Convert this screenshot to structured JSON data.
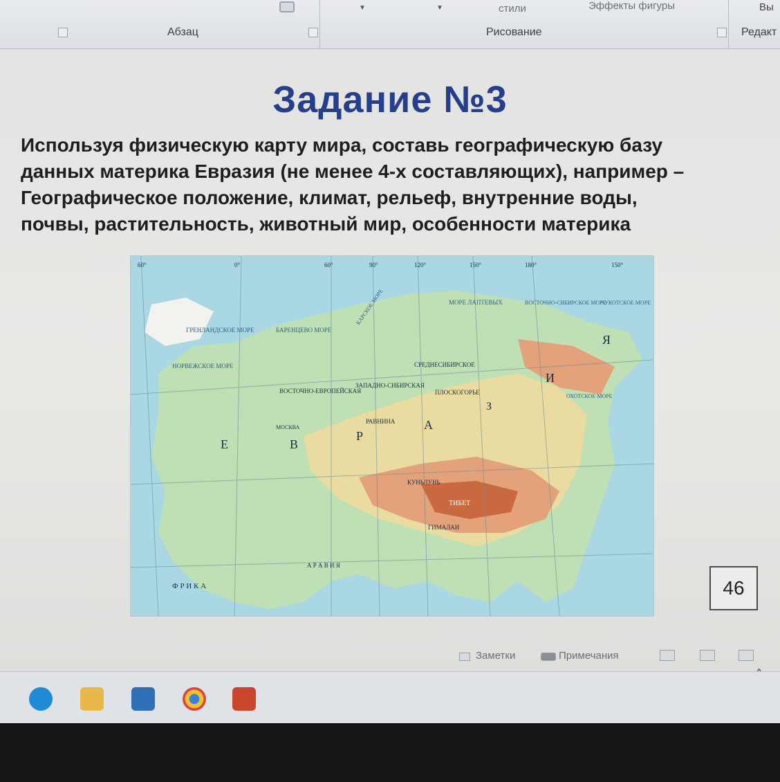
{
  "ribbon": {
    "paragraph_label": "Абзац",
    "drawing_label": "Рисование",
    "edit_label": "Редакт",
    "styles_label": "стили",
    "shape_effects_label": "Эффекты фигуры",
    "select_label": "Вы"
  },
  "slide": {
    "title": "Задание №3",
    "task_lines": [
      "Используя физическую карту мира, составь географическую базу",
      "данных материка Евразия (не менее 4-х составляющих), например –",
      "Географическое положение, климат, рельеф, внутренние воды,",
      "почвы, растительность, животный мир, особенности материка"
    ],
    "page_number": "46"
  },
  "map": {
    "labels": {
      "e": "Е",
      "v": "В",
      "r": "Р",
      "a": "А",
      "z": "З",
      "i": "И",
      "ya": "Я",
      "arabian": "А Р А В И Я",
      "africa": "Ф Р И К А",
      "greenland": "ГРЕНЛАНДСКОЕ МОРЕ",
      "barents": "БАРЕНЦЕВО МОРЕ",
      "norwegian": "НОРВЕЖСКОЕ МОРЕ",
      "kara": "КАРСКОЕ МОРЕ",
      "laptev": "МОРЕ ЛАПТЕВЫХ",
      "east_sib": "ВОСТОЧНО-СИБИРСКОЕ МОРЕ",
      "chukchi": "ЧУКОТСКОЕ МОРЕ",
      "okhotsk": "ОХОТСКОЕ МОРЕ",
      "mid_sib": "СРЕДНЕСИБИРСКОЕ",
      "plateau": "ПЛОСКОГОРЬЕ",
      "east_euro": "ВОСТОЧНО-ЕВРОПЕЙСКАЯ",
      "west_sib": "ЗАПАДНО-СИБИРСКАЯ",
      "plain": "РАВНИНА",
      "tibet": "ТИБЕТ",
      "moscow": "МОСКВА",
      "kunlun": "КУНЬЛУНЬ",
      "himalaya": "ГИМАЛАИ"
    },
    "meridians": [
      "60°",
      "0°",
      "60°",
      "90°",
      "120°",
      "150°",
      "180°",
      "150°"
    ],
    "colors": {
      "sea": "#a9d7e3",
      "lowland": "#bfe0b4",
      "upland": "#eadca0",
      "mountain": "#e3a27a",
      "high": "#c9693f"
    }
  },
  "statusbar": {
    "notes_label": "Заметки",
    "comments_label": "Примечания"
  }
}
